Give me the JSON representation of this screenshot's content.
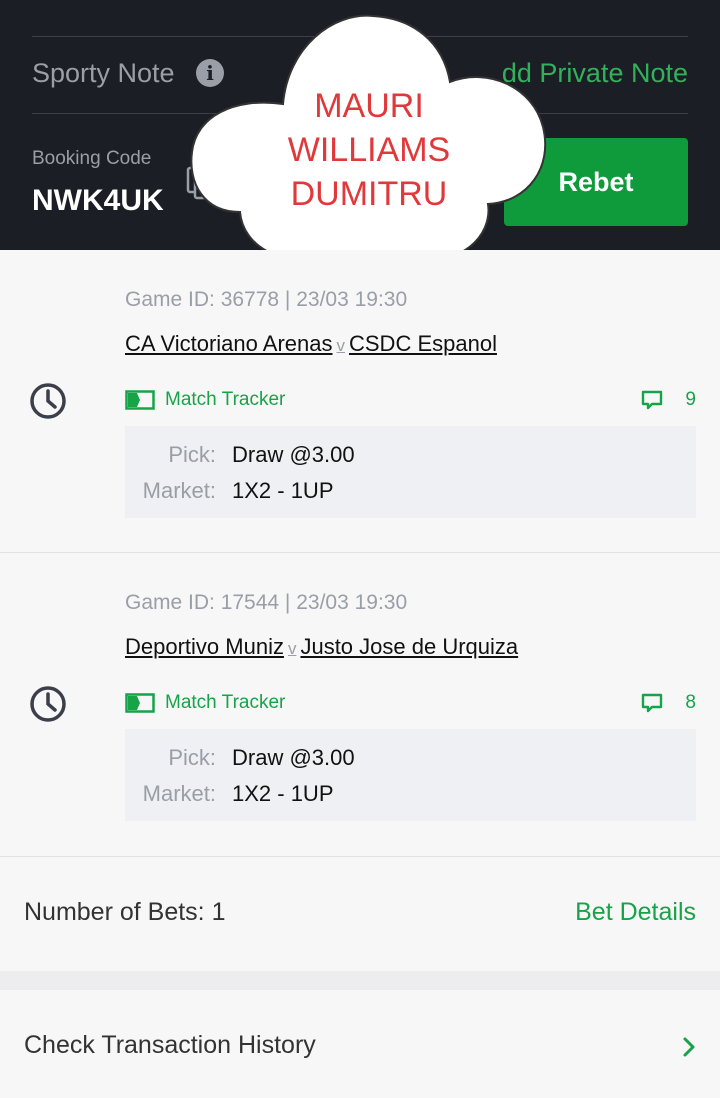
{
  "header": {
    "sporty_note_label": "Sporty Note",
    "add_private_note_label": "dd Private Note",
    "booking_code_label": "Booking Code",
    "booking_code": "NWK4UK",
    "rebet_label": "Rebet"
  },
  "overlay": {
    "line1": "MAURI",
    "line2": "WILLIAMS",
    "line3": "DUMITRU"
  },
  "bets": [
    {
      "game_id": "Game ID: 36778 | 23/03 19:30",
      "home": "CA Victoriano Arenas",
      "vs": "v",
      "away": "CSDC Espanol",
      "tracker_label": "Match Tracker",
      "comment_count": "9",
      "pick_label": "Pick:",
      "pick_value": "Draw @3.00",
      "market_label": "Market:",
      "market_value": "1X2 - 1UP"
    },
    {
      "game_id": "Game ID: 17544 | 23/03 19:30",
      "home": "Deportivo Muniz",
      "vs": "v",
      "away": "Justo Jose de Urquiza",
      "tracker_label": "Match Tracker",
      "comment_count": "8",
      "pick_label": "Pick:",
      "pick_value": "Draw @3.00",
      "market_label": "Market:",
      "market_value": "1X2 - 1UP"
    }
  ],
  "summary": {
    "number_of_bets": "Number of Bets: 1",
    "bet_details_label": "Bet Details"
  },
  "history": {
    "label": "Check Transaction History"
  },
  "colors": {
    "header_bg": "#1b1e25",
    "accent_green": "#0f9a3c",
    "overlay_text": "#e0393b"
  },
  "icons": [
    "info-icon",
    "copy-icon",
    "clock-icon",
    "match-tracker-icon",
    "comment-icon",
    "chevron-right-icon"
  ]
}
